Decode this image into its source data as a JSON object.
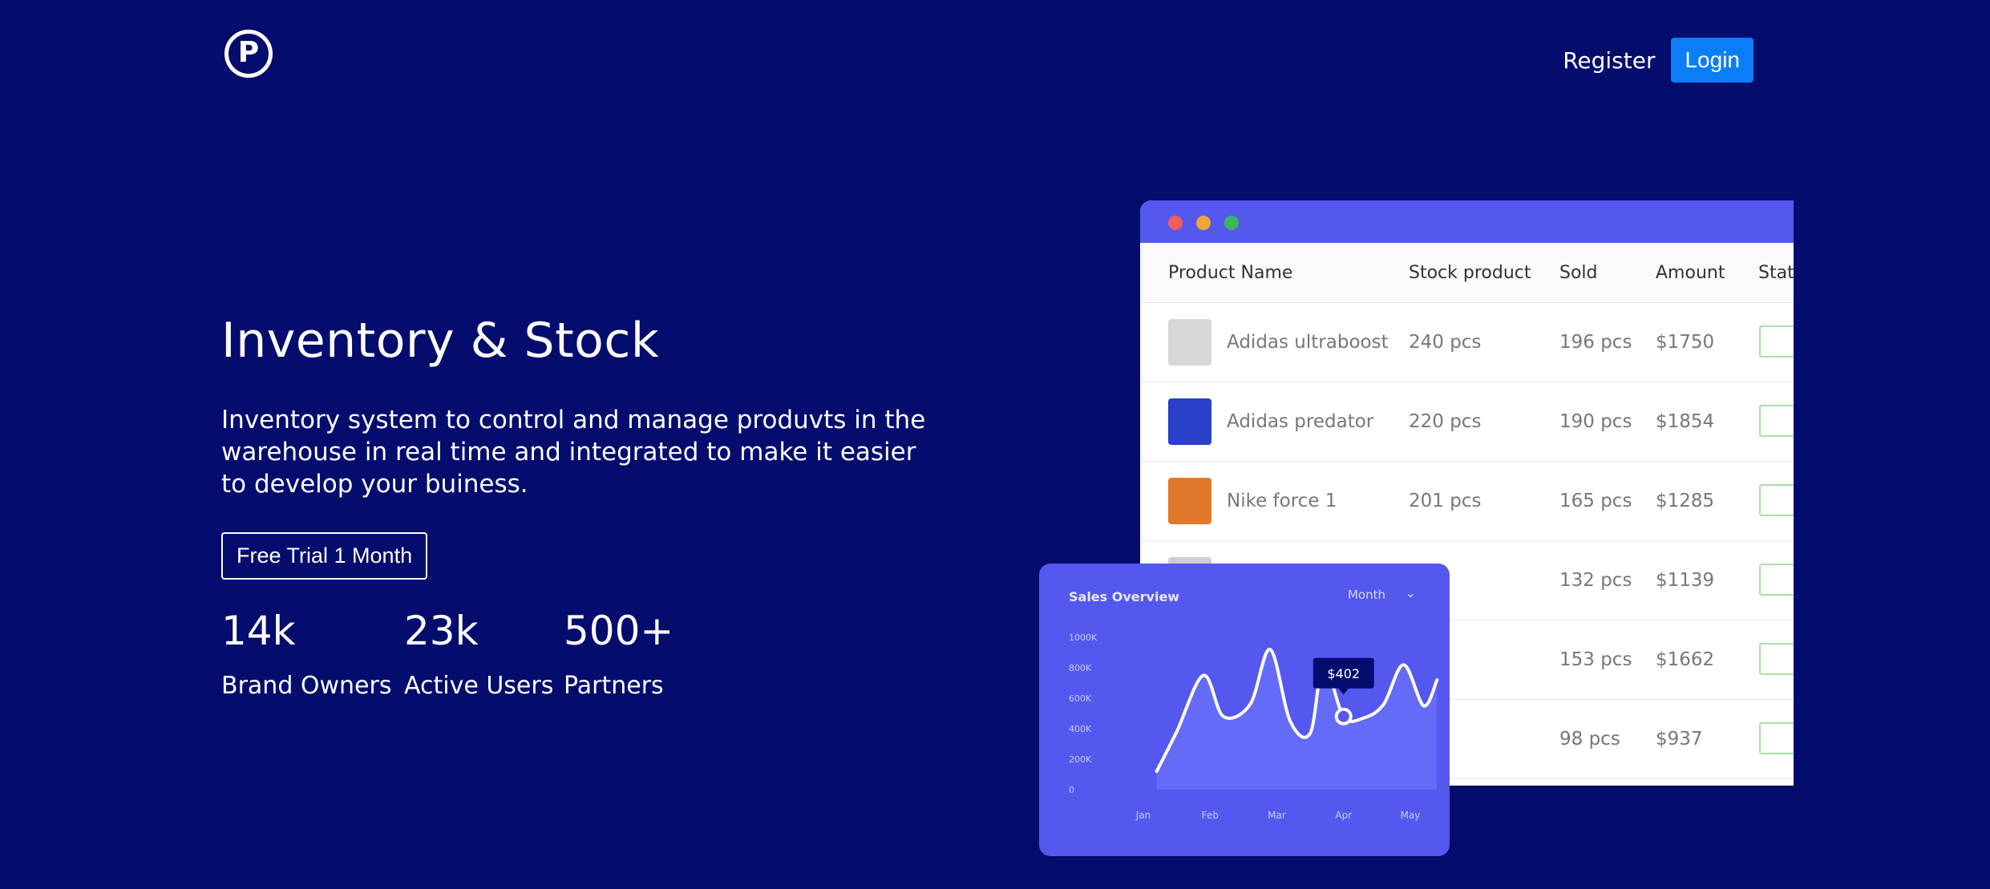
{
  "header": {
    "logo_letter": "P",
    "register_label": "Register",
    "login_label": "Login"
  },
  "hero": {
    "title": "Inventory & Stock",
    "description": "Inventory system to control and manage produvts in the warehouse in real time and integrated to make it easier to develop your buiness.",
    "cta_label": "Free Trial 1 Month"
  },
  "stats": [
    {
      "value": "14k",
      "label": "Brand Owners"
    },
    {
      "value": "23k",
      "label": "Active Users"
    },
    {
      "value": "500+",
      "label": "Partners"
    }
  ],
  "table": {
    "headers": [
      "Product Name",
      "Stock product",
      "Sold",
      "Amount",
      "Stat"
    ],
    "rows": [
      {
        "name": "Adidas ultraboost",
        "stock": "240 pcs",
        "sold": "196 pcs",
        "amount": "$1750"
      },
      {
        "name": "Adidas predator",
        "stock": "220 pcs",
        "sold": "190 pcs",
        "amount": "$1854"
      },
      {
        "name": "Nike force 1",
        "stock": "201 pcs",
        "sold": "165 pcs",
        "amount": "$1285"
      },
      {
        "name": "",
        "stock": "cs",
        "sold": "132 pcs",
        "amount": "$1139"
      },
      {
        "name": "",
        "stock": "cs",
        "sold": "153 pcs",
        "amount": "$1662"
      },
      {
        "name": "",
        "stock": "pcs",
        "sold": "98 pcs",
        "amount": "$937"
      }
    ],
    "thumb_colors": [
      "#d8d8d8",
      "#2a40c8",
      "#e07a2a",
      "#cfcfcf",
      "#cfcfcf",
      "#cfcfcf"
    ]
  },
  "sales": {
    "title": "Sales Overview",
    "period": "Month",
    "tooltip": "$402"
  },
  "chart_data": {
    "type": "line",
    "categories": [
      "Jan",
      "Feb",
      "Mar",
      "Apr",
      "May"
    ],
    "y_ticks": [
      "1000K",
      "800K",
      "600K",
      "400K",
      "200K",
      "0"
    ],
    "ylim": [
      0,
      1000
    ],
    "x": [
      0.2,
      0.5,
      0.9,
      1.2,
      1.6,
      1.9,
      2.2,
      2.5,
      2.7,
      3.0,
      3.3,
      3.6,
      3.9,
      4.2,
      4.4
    ],
    "values": [
      120,
      380,
      750,
      480,
      560,
      920,
      450,
      370,
      820,
      480,
      470,
      560,
      820,
      550,
      720
    ],
    "highlight_x": 3.0,
    "highlight_value": 480,
    "colors": {
      "line": "#ffffff",
      "card": "#5458ef"
    }
  }
}
